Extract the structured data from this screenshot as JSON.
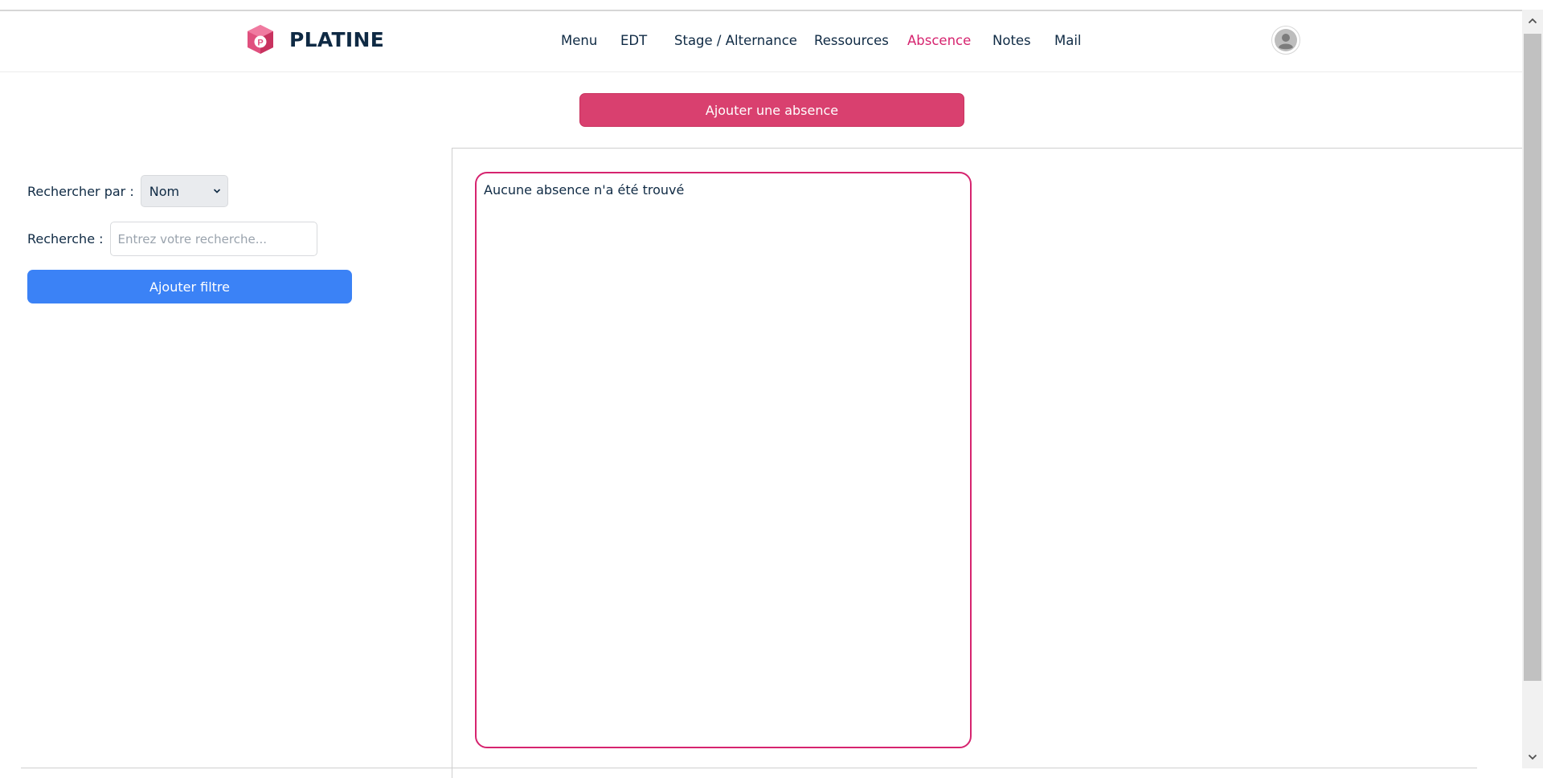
{
  "brand": {
    "name": "PLATINE"
  },
  "nav": {
    "items": [
      {
        "label": "Menu",
        "active": false
      },
      {
        "label": "EDT",
        "active": false
      },
      {
        "label": "Stage / Alternance",
        "active": false
      },
      {
        "label": "Ressources",
        "active": false
      },
      {
        "label": "Abscence",
        "active": true
      },
      {
        "label": "Notes",
        "active": false
      },
      {
        "label": "Mail",
        "active": false
      }
    ]
  },
  "actions": {
    "add_absence_label": "Ajouter une absence"
  },
  "filters": {
    "search_by_label": "Rechercher par :",
    "search_by_value": "Nom",
    "search_label": "Recherche :",
    "search_placeholder": "Entrez votre recherche...",
    "search_value": "",
    "add_filter_label": "Ajouter filtre"
  },
  "results": {
    "empty_message": "Aucune absence n'a été trouvé"
  },
  "colors": {
    "brand_pink": "#d9406f",
    "active_nav": "#d6246f",
    "filter_blue": "#3b82f6",
    "text_dark": "#0f2a44"
  },
  "icons": {
    "logo": "platine-logo-icon",
    "avatar": "user-avatar-icon",
    "select": "chevron-down-icon"
  }
}
